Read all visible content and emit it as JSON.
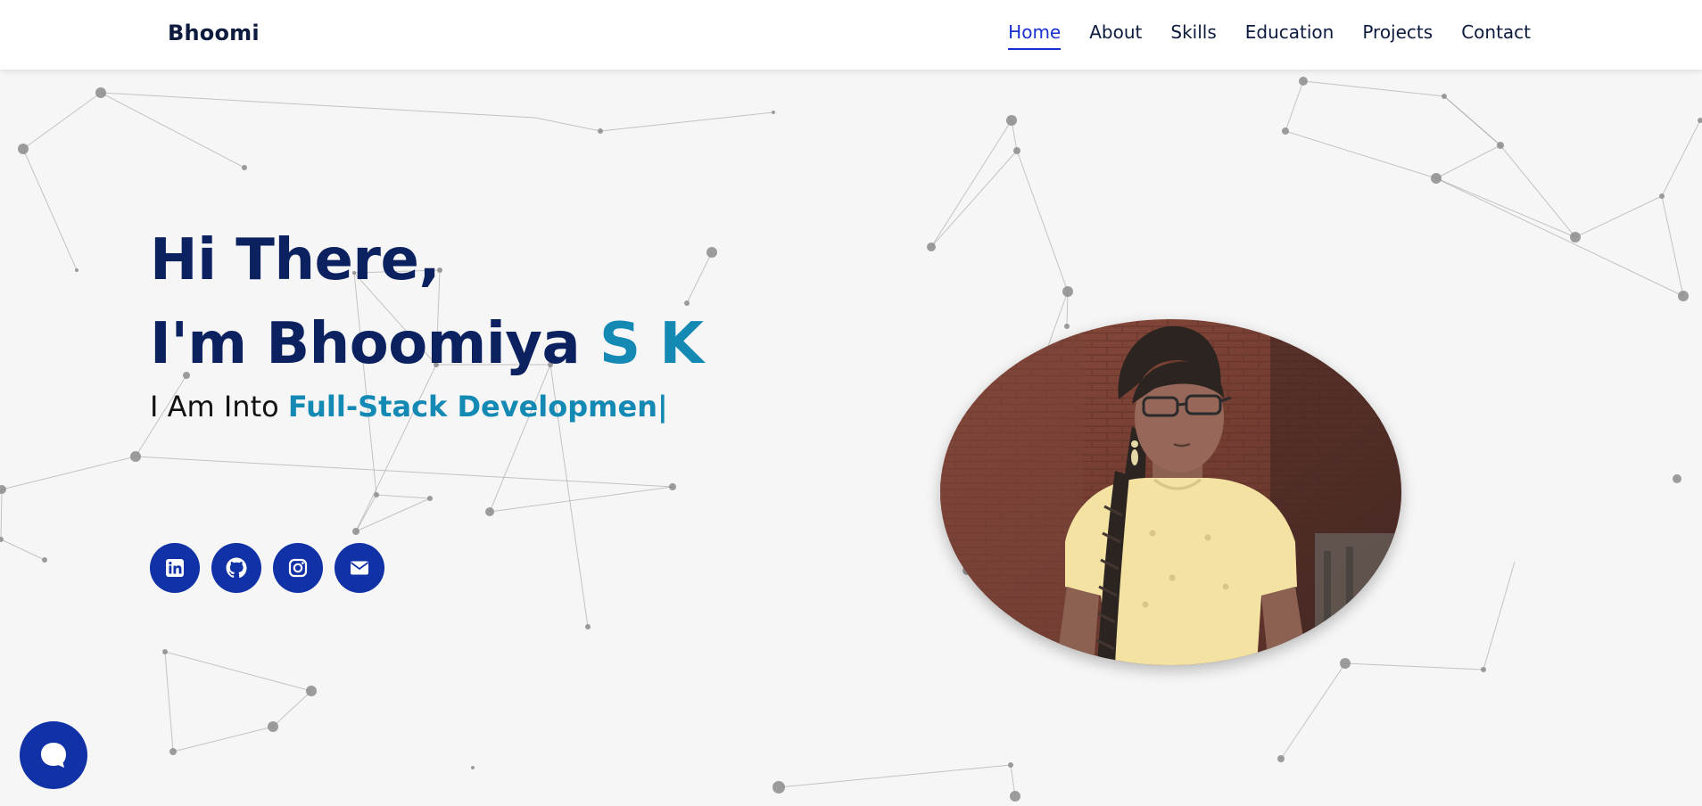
{
  "nav": {
    "logo": "Bhoomi",
    "links": [
      {
        "label": "Home",
        "active": true
      },
      {
        "label": "About"
      },
      {
        "label": "Skills"
      },
      {
        "label": "Education"
      },
      {
        "label": "Projects"
      },
      {
        "label": "Contact"
      }
    ]
  },
  "hero": {
    "greeting": "Hi There,",
    "name_prefix": "I'm Bhoomiya ",
    "name_accent": "S K",
    "tagline_prefix": "I Am Into ",
    "tagline_typed": "Full-Stack Developmen",
    "cursor": "|"
  },
  "socials": [
    {
      "icon": "linkedin-icon"
    },
    {
      "icon": "github-icon"
    },
    {
      "icon": "instagram-icon"
    },
    {
      "icon": "email-icon"
    }
  ],
  "photo": {
    "icon": "profile-photo"
  },
  "chat": {
    "icon": "chat-bubble-icon"
  },
  "colors": {
    "primary": "#0b2160",
    "accent": "#1389b4",
    "button": "#1131a6",
    "nav_active": "#1a2fd0",
    "background": "#f6f6f6"
  }
}
